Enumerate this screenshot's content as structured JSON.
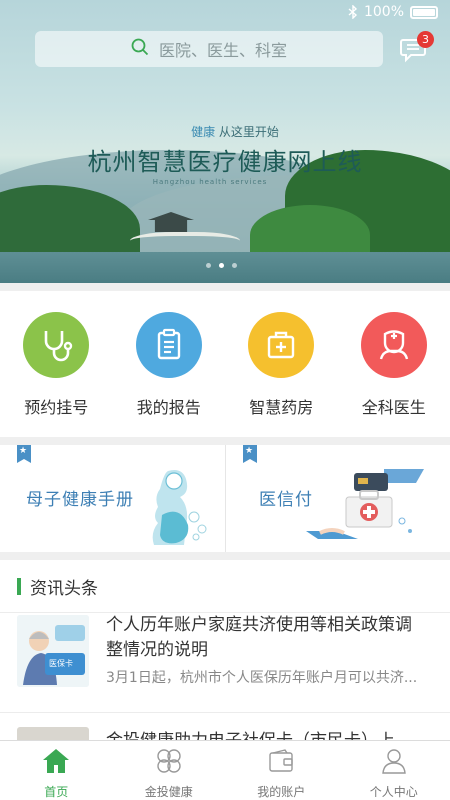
{
  "status_bar": {
    "battery": "100%"
  },
  "search": {
    "placeholder": "医院、医生、科室"
  },
  "messages": {
    "badge_count": "3"
  },
  "banner": {
    "tag_accent": "健康",
    "tag_rest": " 从这里开始",
    "title": "杭州智慧医疗健康网上线",
    "subtitle": "Hangzhou health services",
    "pages": 3,
    "active_page": 2
  },
  "services": [
    {
      "label": "预约挂号",
      "icon": "stethoscope-icon",
      "color": "#8bc34a"
    },
    {
      "label": "我的报告",
      "icon": "clipboard-icon",
      "color": "#4fa9df"
    },
    {
      "label": "智慧药房",
      "icon": "medicine-box-icon",
      "color": "#f5c02e"
    },
    {
      "label": "全科医生",
      "icon": "doctor-icon",
      "color": "#f25a5a"
    }
  ],
  "promos": [
    {
      "title": "母子健康手册"
    },
    {
      "title": "医信付"
    }
  ],
  "news": {
    "header": "资讯头条",
    "items": [
      {
        "title": "个人历年账户家庭共济使用等相关政策调整情况的说明",
        "summary": "3月1日起，杭州市个人医保历年账户月可以共济...",
        "thumb_text": "医保卡"
      },
      {
        "title": "金投健康助力电子社保卡（市民卡）上"
      }
    ]
  },
  "tabbar": [
    {
      "label": "首页",
      "active": true
    },
    {
      "label": "金投健康",
      "active": false
    },
    {
      "label": "我的账户",
      "active": false
    },
    {
      "label": "个人中心",
      "active": false
    }
  ],
  "colors": {
    "accent_green": "#3aa853",
    "badge_red": "#e53935",
    "promo_blue": "#3d7fb4"
  }
}
